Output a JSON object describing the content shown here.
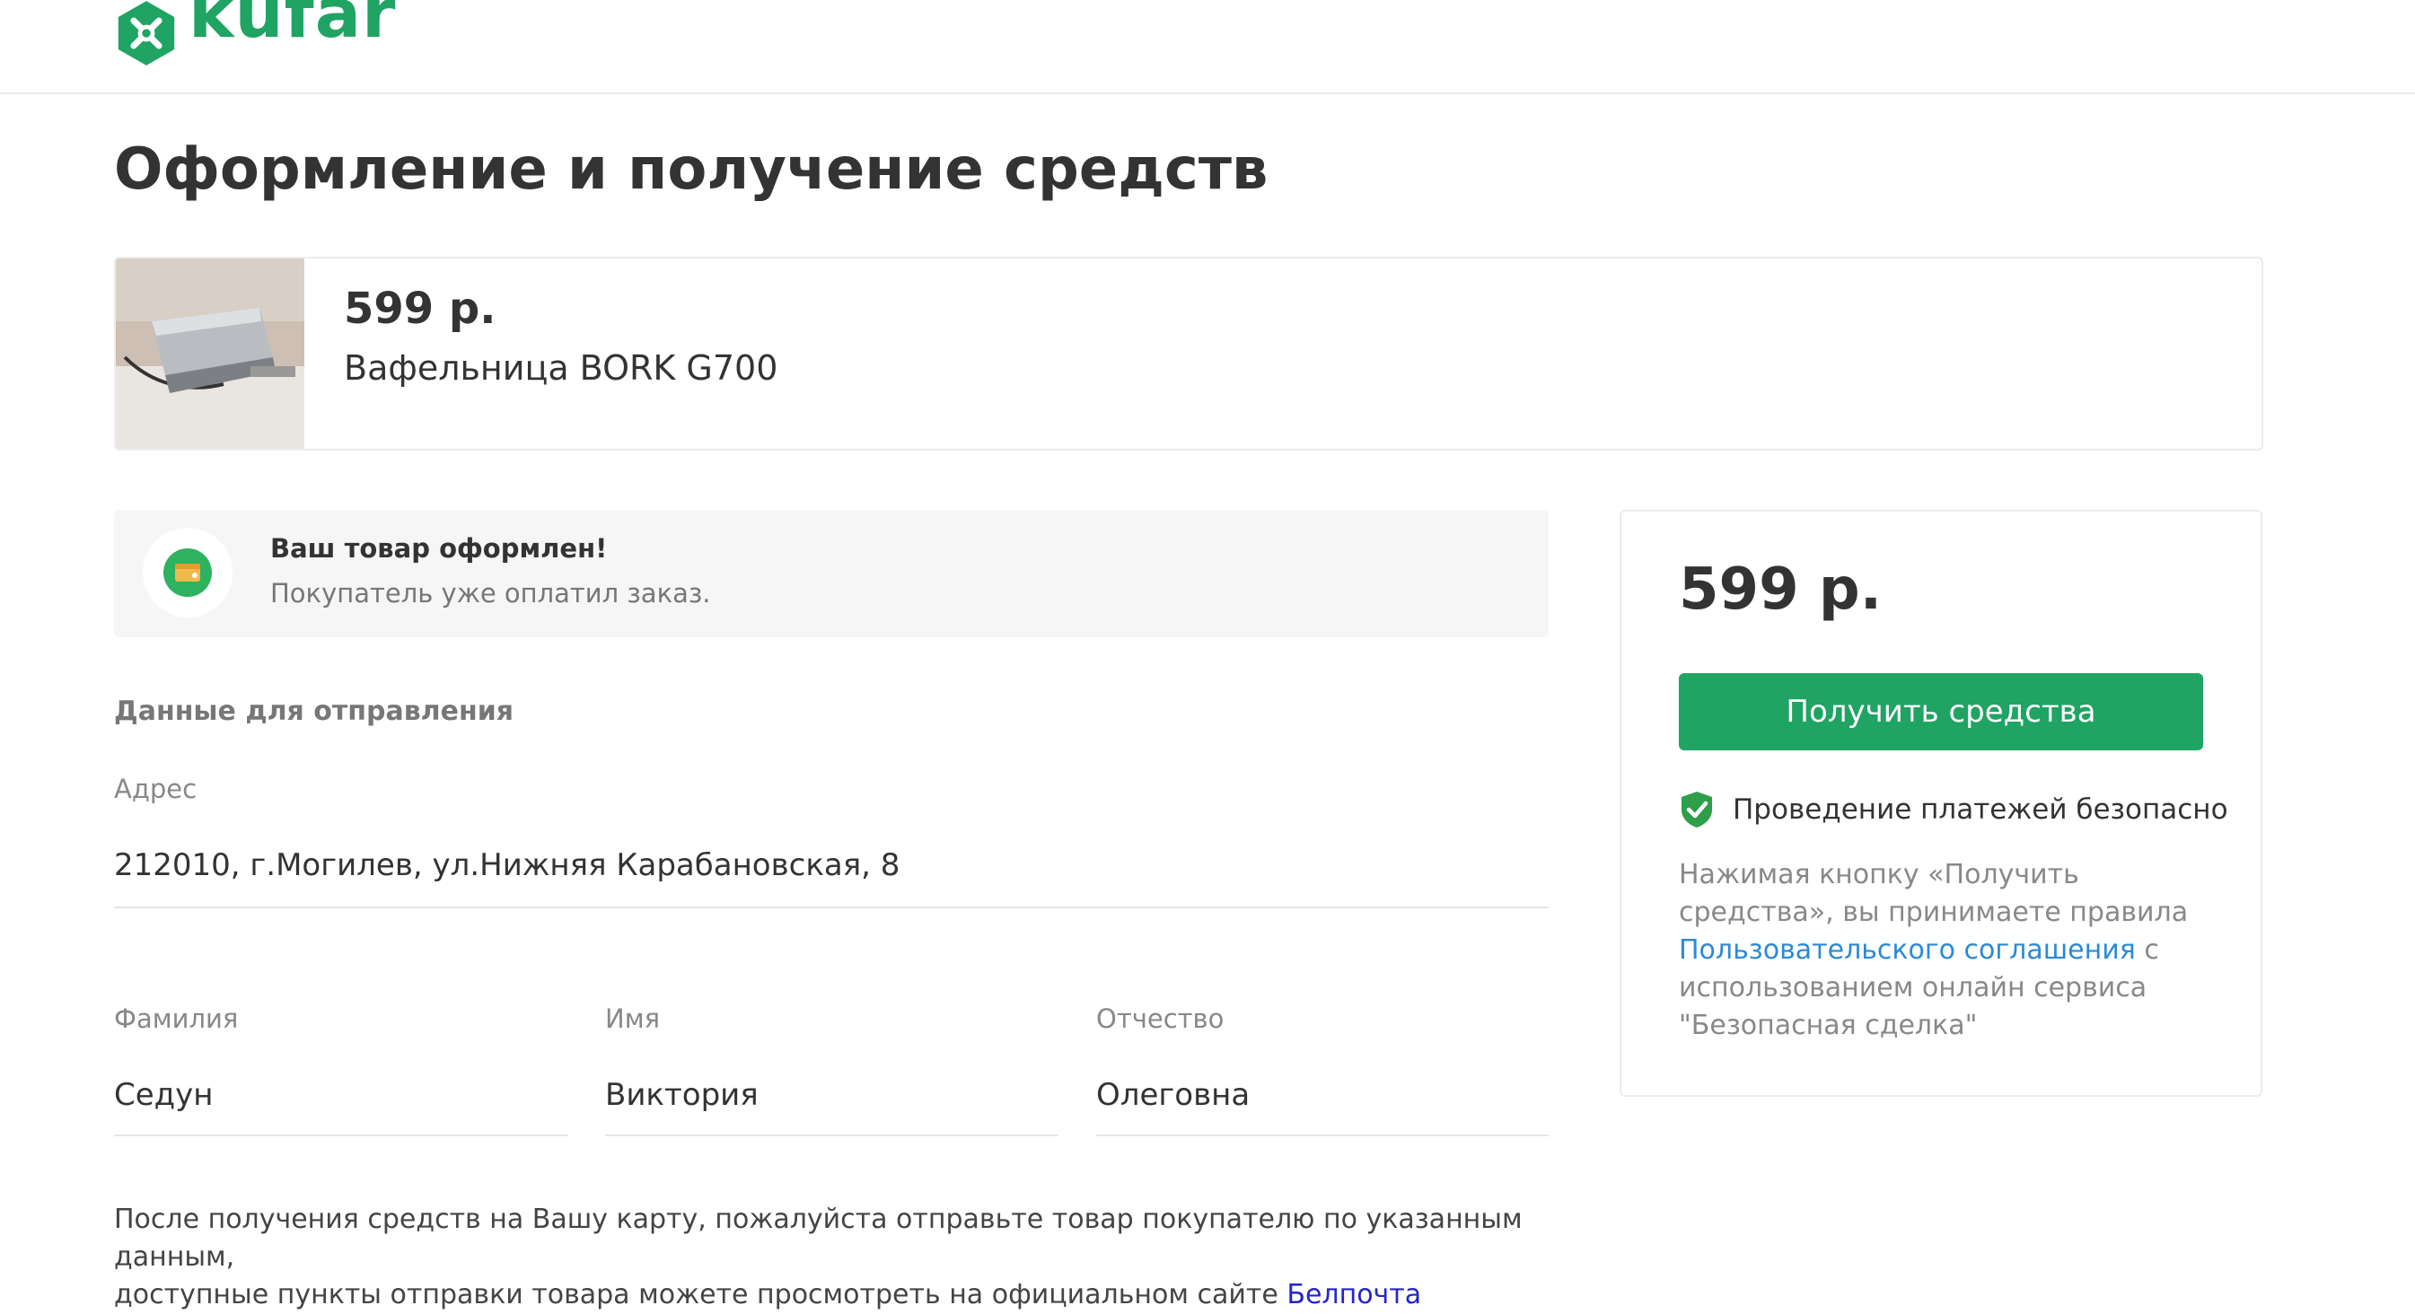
{
  "brand": {
    "name": "kufar",
    "accent": "#1fa463"
  },
  "page": {
    "title": "Оформление и получение средств"
  },
  "product": {
    "price": "599 р.",
    "name": "Вафельница BORK G700",
    "image_icon": "waffle-maker-photo"
  },
  "status": {
    "icon": "wallet-icon",
    "title": "Ваш товар оформлен!",
    "subtitle": "Покупатель уже оплатил заказ."
  },
  "shipping": {
    "section_title": "Данные для отправления",
    "address_label": "Адрес",
    "address_value": "212010, г.Могилев, ул.Нижняя Карабановская, 8",
    "surname_label": "Фамилия",
    "surname_value": "Седун",
    "name_label": "Имя",
    "name_value": "Виктория",
    "patronymic_label": "Отчество",
    "patronymic_value": "Олеговна"
  },
  "note": {
    "line1": "После получения средств на Вашу карту, пожалуйста отправьте товар покупателю по указанным данным,",
    "line2": "доступные пункты отправки товара можете просмотреть на официальном сайте",
    "link": "Белпочта"
  },
  "sidebar": {
    "price": "599 р.",
    "button_label": "Получить средства",
    "secure_icon": "shield-check-icon",
    "secure_text": "Проведение платежей безопасно",
    "legal_prefix": "Нажимая кнопку «Получить средства», вы принимаете правила",
    "legal_link": "Пользовательского соглашения",
    "legal_suffix": "с использованием онлайн сервиса \"Безопасная сделка\""
  }
}
